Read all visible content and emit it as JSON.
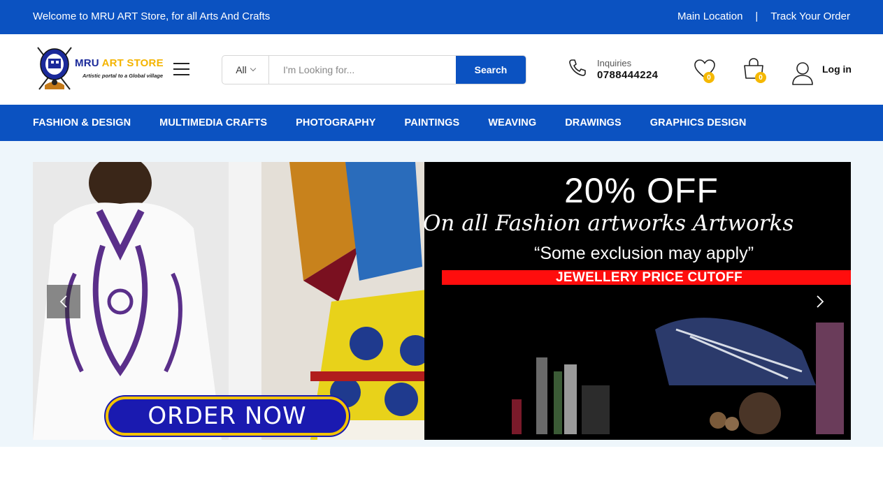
{
  "topbar": {
    "welcome": "Welcome to MRU ART Store, for all Arts And Crafts",
    "main_location": "Main Location",
    "separator": "|",
    "track_order": "Track Your Order"
  },
  "header": {
    "logo": {
      "title_main": "MRU ",
      "title_accent": "ART STORE",
      "tagline": "Artistic portal to a Global village"
    },
    "search": {
      "category": "All",
      "placeholder": "I'm Looking for...",
      "button": "Search"
    },
    "inquiry": {
      "label": "Inquiries",
      "phone": "0788444224"
    },
    "wishlist_count": "0",
    "cart_count": "0",
    "login": "Log in"
  },
  "nav": {
    "items": [
      "FASHION & DESIGN",
      "MULTIMEDIA CRAFTS",
      "PHOTOGRAPHY",
      "PAINTINGS",
      "WEAVING",
      "DRAWINGS",
      "GRAPHICS DESIGN"
    ]
  },
  "banner": {
    "headline": "20% OFF",
    "subhead": "On all Fashion artworks Artworks",
    "note": "“Some exclusion may apply”",
    "strip": "JEWELLERY PRICE CUTOFF",
    "cta": "ORDER NOW"
  },
  "colors": {
    "brand_blue": "#0b52c1",
    "badge_yellow": "#f5b800",
    "strip_red": "#ff0d0d"
  }
}
